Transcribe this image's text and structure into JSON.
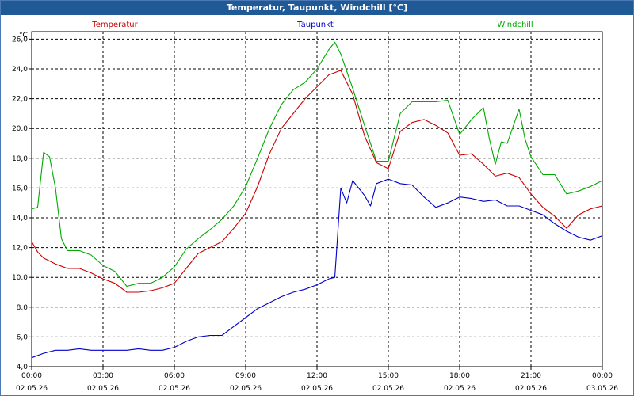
{
  "window_title": "Temperatur, Taupunkt, Windchill [°C]",
  "chart_data": {
    "type": "line",
    "title": "Temperatur, Taupunkt, Windchill [°C]",
    "ylabel": "°C",
    "xlabel": "",
    "ylim": [
      4.0,
      26.5
    ],
    "y_ticks": [
      "4,0",
      "6,0",
      "8,0",
      "10,0",
      "12,0",
      "14,0",
      "16,0",
      "18,0",
      "20,0",
      "22,0",
      "24,0",
      "26,0"
    ],
    "y_tick_values": [
      4,
      6,
      8,
      10,
      12,
      14,
      16,
      18,
      20,
      22,
      24,
      26
    ],
    "xlim": [
      0,
      24
    ],
    "x_tick_values": [
      0,
      3,
      6,
      9,
      12,
      15,
      18,
      21,
      24
    ],
    "x_tick_times": [
      "00:00",
      "03:00",
      "06:00",
      "09:00",
      "12:00",
      "15:00",
      "18:00",
      "21:00",
      "00:00"
    ],
    "x_tick_dates": [
      "02.05.26",
      "02.05.26",
      "02.05.26",
      "02.05.26",
      "02.05.26",
      "02.05.26",
      "02.05.26",
      "02.05.26",
      "03.05.26"
    ],
    "grid": true,
    "legend_position": "top",
    "series": [
      {
        "name": "Temperatur",
        "color": "#cc0000",
        "x": [
          0,
          0.25,
          0.5,
          1,
          1.5,
          2,
          2.5,
          3,
          3.5,
          4,
          4.5,
          5,
          5.5,
          6,
          6.5,
          7,
          7.5,
          8,
          8.5,
          9,
          9.5,
          10,
          10.5,
          11,
          11.5,
          12,
          12.5,
          13,
          13.5,
          14,
          14.5,
          15,
          15.5,
          16,
          16.5,
          17,
          17.5,
          18,
          18.5,
          19,
          19.5,
          20,
          20.5,
          21,
          21.5,
          22,
          22.5,
          23,
          23.5,
          24
        ],
        "values": [
          12.4,
          11.7,
          11.3,
          10.9,
          10.6,
          10.6,
          10.3,
          9.9,
          9.6,
          9.0,
          9.0,
          9.1,
          9.3,
          9.6,
          10.6,
          11.6,
          12.0,
          12.4,
          13.3,
          14.3,
          16.1,
          18.3,
          20.0,
          21.0,
          22.0,
          22.8,
          23.6,
          23.9,
          22.3,
          19.5,
          17.7,
          17.3,
          19.8,
          20.4,
          20.6,
          20.2,
          19.7,
          18.2,
          18.3,
          17.6,
          16.8,
          17.0,
          16.7,
          15.6,
          14.7,
          14.1,
          13.3,
          14.2,
          14.6,
          14.8
        ]
      },
      {
        "name": "Taupunkt",
        "color": "#0000cc",
        "x": [
          0,
          0.5,
          1,
          1.5,
          2,
          2.5,
          3,
          3.5,
          4,
          4.5,
          5,
          5.5,
          6,
          6.5,
          7,
          7.5,
          8,
          8.5,
          9,
          9.5,
          10,
          10.5,
          11,
          11.5,
          12,
          12.5,
          12.75,
          13,
          13.25,
          13.5,
          13.75,
          14,
          14.25,
          14.5,
          15,
          15.5,
          16,
          16.5,
          17,
          17.5,
          18,
          18.5,
          19,
          19.5,
          20,
          20.5,
          21,
          21.5,
          22,
          22.5,
          23,
          23.5,
          24
        ],
        "values": [
          4.6,
          4.9,
          5.1,
          5.1,
          5.2,
          5.1,
          5.1,
          5.1,
          5.1,
          5.2,
          5.1,
          5.1,
          5.3,
          5.7,
          6.0,
          6.1,
          6.1,
          6.7,
          7.3,
          7.9,
          8.3,
          8.7,
          9.0,
          9.2,
          9.5,
          9.9,
          10.0,
          16.0,
          15.0,
          16.5,
          16.0,
          15.5,
          14.8,
          16.3,
          16.6,
          16.3,
          16.2,
          15.4,
          14.7,
          15.0,
          15.4,
          15.3,
          15.1,
          15.2,
          14.8,
          14.8,
          14.5,
          14.2,
          13.6,
          13.1,
          12.7,
          12.5,
          12.8
        ]
      },
      {
        "name": "Windchill",
        "color": "#00aa00",
        "x": [
          0,
          0.25,
          0.5,
          0.75,
          1,
          1.25,
          1.5,
          2,
          2.5,
          3,
          3.5,
          4,
          4.5,
          5,
          5.5,
          6,
          6.5,
          7,
          7.5,
          8,
          8.5,
          9,
          9.5,
          10,
          10.5,
          11,
          11.5,
          12,
          12.5,
          12.75,
          13,
          13.5,
          14,
          14.5,
          15,
          15.5,
          16,
          16.5,
          17,
          17.5,
          18,
          18.5,
          19,
          19.25,
          19.5,
          19.75,
          20,
          20.5,
          20.75,
          21,
          21.5,
          22,
          22.5,
          23,
          23.5,
          24
        ],
        "values": [
          14.6,
          14.7,
          18.4,
          18.1,
          16.0,
          12.6,
          11.8,
          11.8,
          11.5,
          10.8,
          10.4,
          9.4,
          9.6,
          9.6,
          10.0,
          10.7,
          11.9,
          12.6,
          13.2,
          13.9,
          14.8,
          16.1,
          18.0,
          20.0,
          21.6,
          22.6,
          23.1,
          24.0,
          25.3,
          25.8,
          25.0,
          22.7,
          20.2,
          17.8,
          17.8,
          21.0,
          21.8,
          21.8,
          21.8,
          21.9,
          19.6,
          20.6,
          21.4,
          19.3,
          17.6,
          19.1,
          19.0,
          21.3,
          19.3,
          18.1,
          16.9,
          16.9,
          15.6,
          15.8,
          16.1,
          16.5
        ]
      }
    ]
  }
}
